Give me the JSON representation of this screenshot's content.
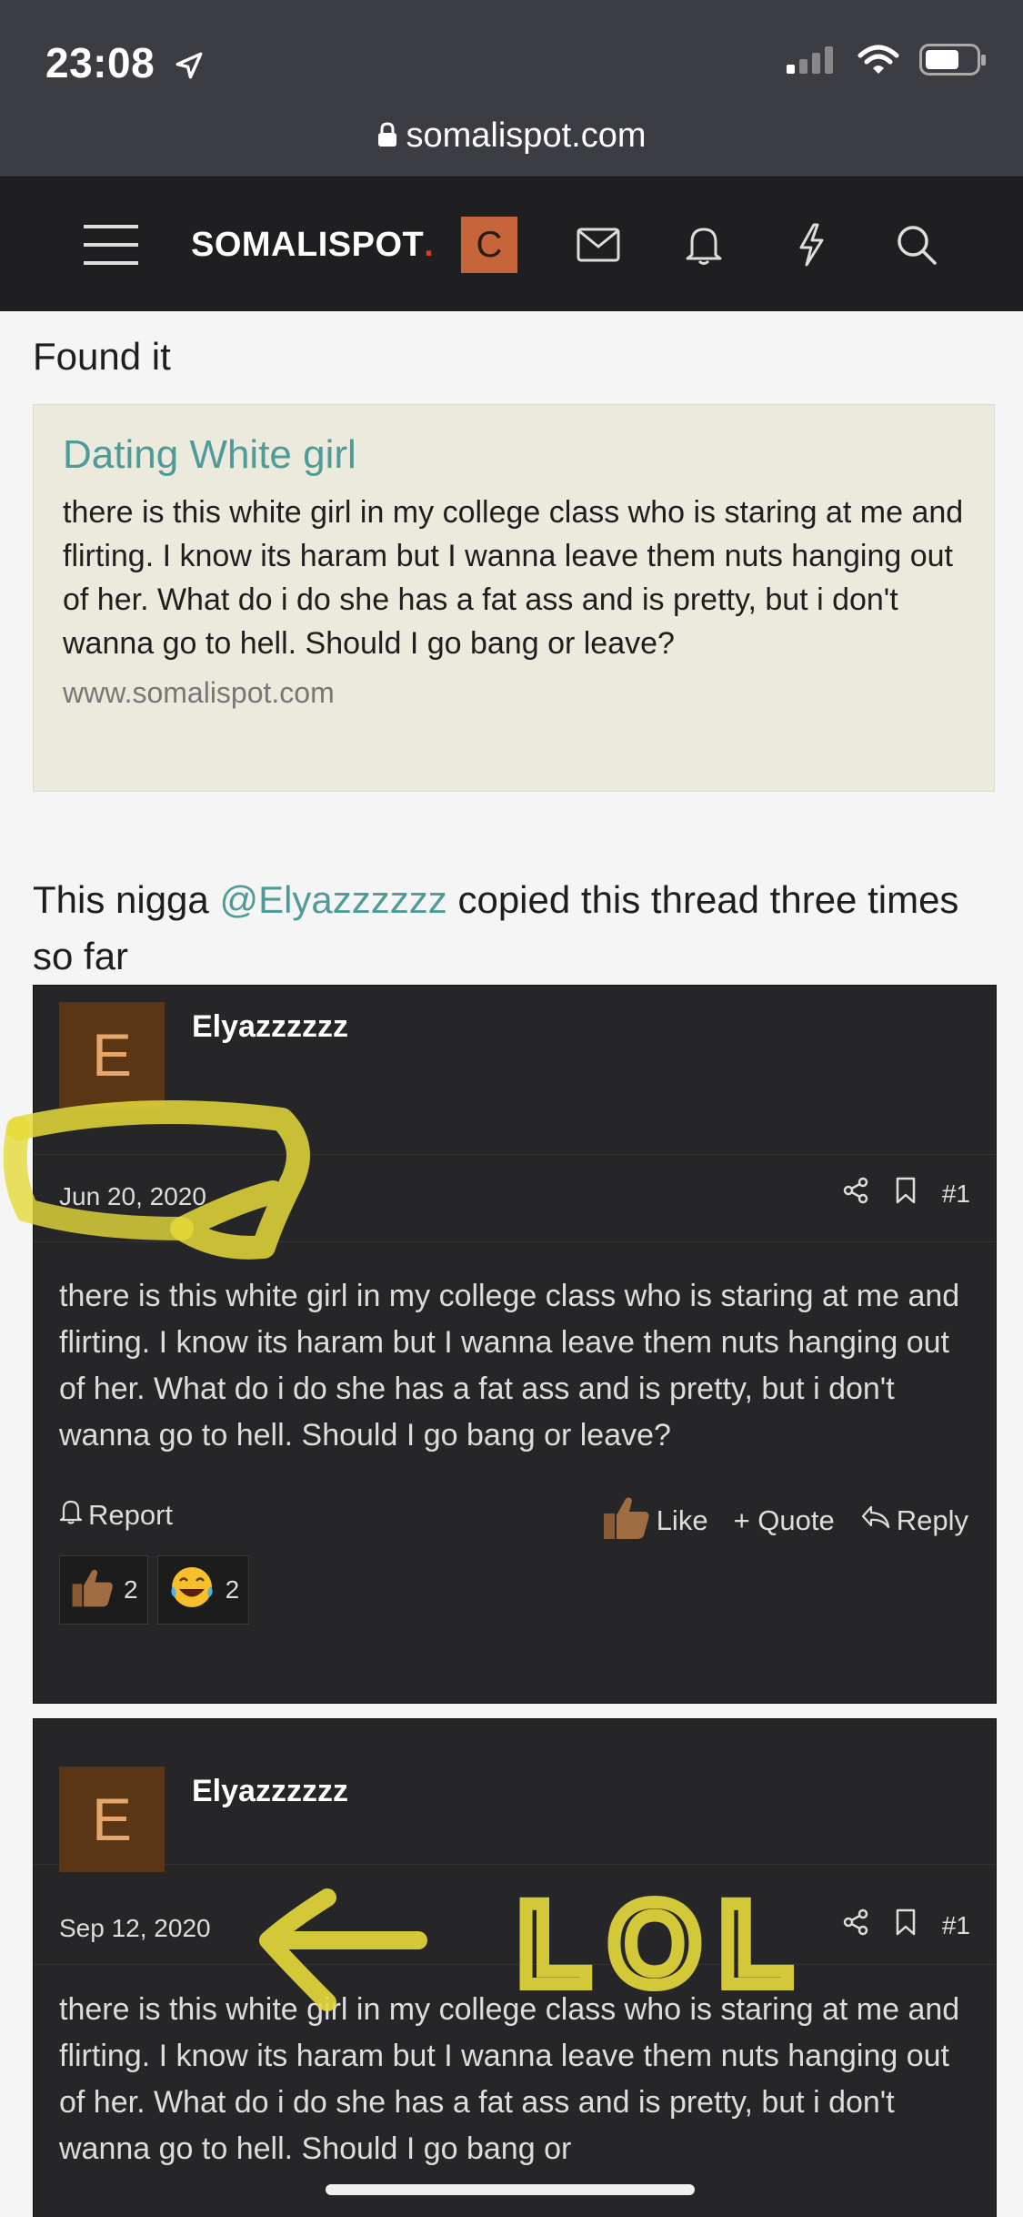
{
  "status": {
    "time": "23:08"
  },
  "browser": {
    "url": "somalispot.com"
  },
  "site": {
    "logo_text": "SOMALISPOT",
    "logo_dot": ".",
    "user_initial": "C",
    "accent": "#c7653a"
  },
  "message": {
    "intro": "Found it",
    "unfurl": {
      "title": "Dating White girl",
      "body": "there is this white girl in my college class who is staring at me and flirting. I know its haram but I wanna leave them nuts hanging out of her. What do i do she has a fat ass and is pretty, but i don't wanna go to hell. Should I go bang or leave?",
      "url": "www.somalispot.com"
    },
    "remark_before": "This nigga ",
    "remark_mention": "@Elyazzzzzz",
    "remark_after": " copied this thread three times so far"
  },
  "posts": [
    {
      "avatar_letter": "E",
      "username": "Elyazzzzzz",
      "date": "Jun 20, 2020",
      "post_number": "#1",
      "body": "there is this white girl in my college class who is staring at me and flirting. I know its haram but I wanna leave them nuts hanging out of her. What do i do she has a fat ass and is pretty, but i don't wanna go to hell. Should I go bang or leave?",
      "report_label": "Report",
      "like_label": "Like",
      "quote_label": "+ Quote",
      "reply_label": "Reply",
      "reactions": [
        {
          "icon": "thumbs-up-icon",
          "count": "2"
        },
        {
          "icon": "laughing-emoji-icon",
          "count": "2"
        }
      ]
    },
    {
      "avatar_letter": "E",
      "username": "Elyazzzzzz",
      "date": "Sep 12, 2020",
      "post_number": "#1",
      "body": "there is this white girl in my college class who is staring at me and flirting. I know its haram but I wanna leave them nuts hanging out of her. What do i do she has a fat ass and is pretty, but i don't wanna go to hell. Should I go bang or"
    }
  ],
  "annotations": {
    "second_post_text": "LOL",
    "marker_color": "#e6da3a"
  }
}
